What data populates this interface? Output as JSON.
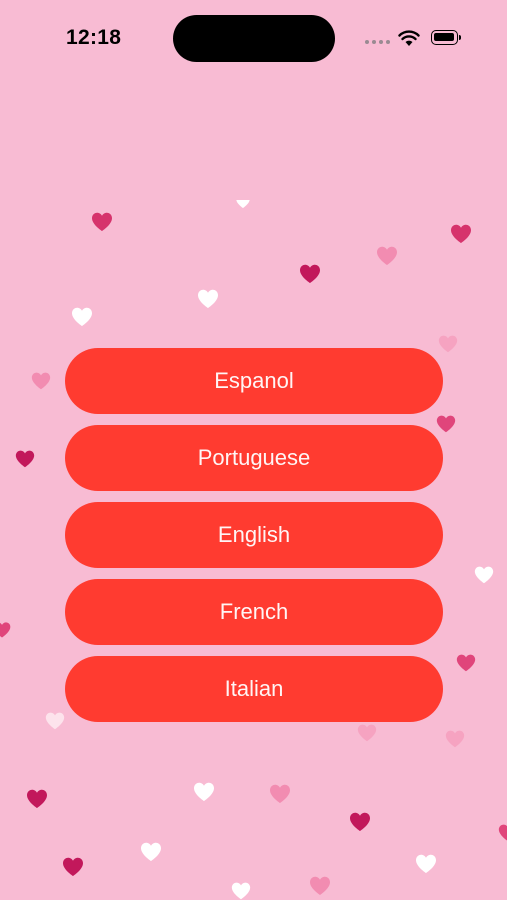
{
  "status_bar": {
    "time": "12:18",
    "icons": [
      "signal-icon",
      "wifi-icon",
      "battery-icon"
    ]
  },
  "background": {
    "color": "#f8bbd3",
    "decoration": "heart-icon",
    "heart_colors": [
      "#d6336c",
      "#f28cb1",
      "#ffffff",
      "#f6a3c1"
    ]
  },
  "languages": [
    {
      "label": "Espanol"
    },
    {
      "label": "Portuguese"
    },
    {
      "label": "English"
    },
    {
      "label": "French"
    },
    {
      "label": "Italian"
    }
  ],
  "colors": {
    "button": "#ff3b30",
    "button_text": "#fff5f5"
  }
}
